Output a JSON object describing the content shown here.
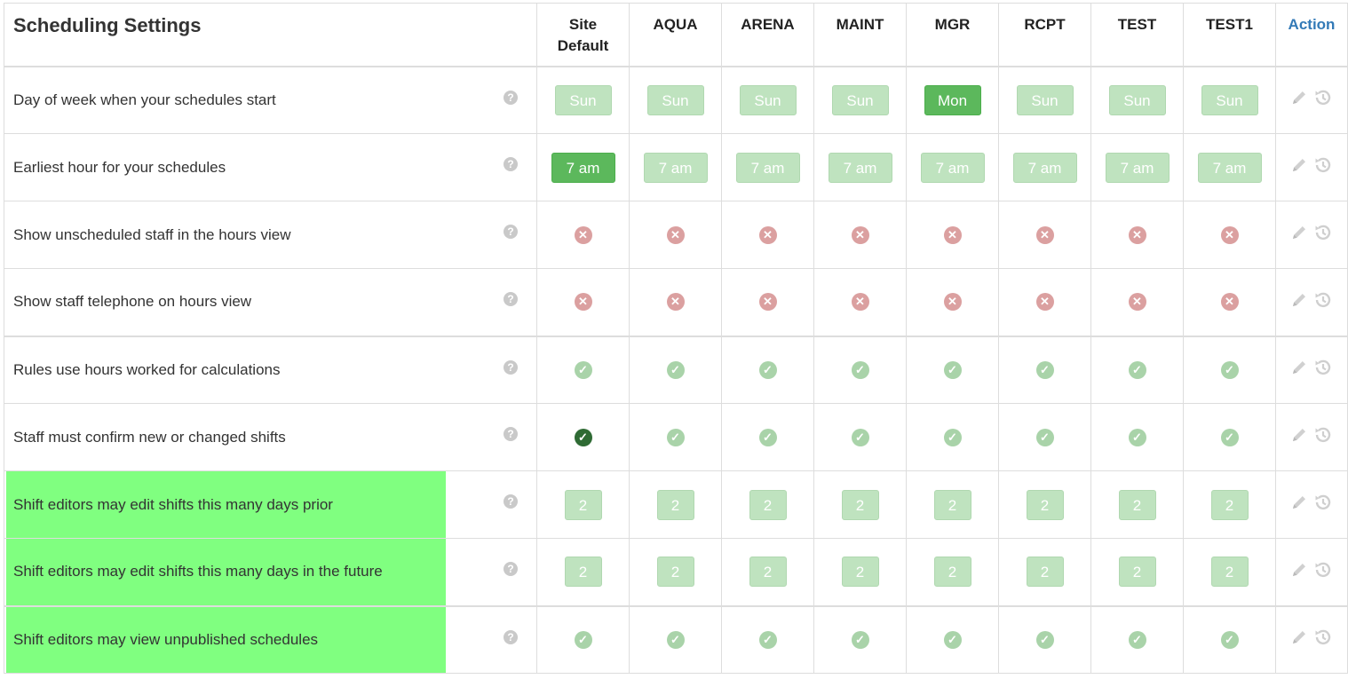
{
  "header": {
    "title": "Scheduling Settings",
    "columns": [
      "Site\nDefault",
      "AQUA",
      "ARENA",
      "MAINT",
      "MGR",
      "RCPT",
      "TEST",
      "TEST1"
    ],
    "action": "Action"
  },
  "help_glyph": "?",
  "colors": {
    "active_green": "#5cb85c",
    "inactive_green": "#bfe3bf",
    "no_red": "#dba0a0",
    "yes_green": "#a9d3a9",
    "yes_dark": "#2f6b34",
    "highlight": "#80ff80",
    "action_blue": "#337ab7"
  },
  "rows": [
    {
      "label": "Day of week when your schedules start",
      "type": "pill-day",
      "values": [
        "Sun",
        "Sun",
        "Sun",
        "Sun",
        "Mon",
        "Sun",
        "Sun",
        "Sun"
      ],
      "active": [
        false,
        false,
        false,
        false,
        true,
        false,
        false,
        false
      ]
    },
    {
      "label": "Earliest hour for your schedules",
      "type": "pill-hour",
      "values": [
        "7 am",
        "7 am",
        "7 am",
        "7 am",
        "7 am",
        "7 am",
        "7 am",
        "7 am"
      ],
      "active": [
        true,
        false,
        false,
        false,
        false,
        false,
        false,
        false
      ]
    },
    {
      "label": "Show unscheduled staff in the hours view",
      "type": "no",
      "values": [
        false,
        false,
        false,
        false,
        false,
        false,
        false,
        false
      ],
      "active": [
        false,
        false,
        false,
        false,
        false,
        false,
        false,
        false
      ]
    },
    {
      "label": "Show staff telephone on hours view",
      "type": "no",
      "values": [
        false,
        false,
        false,
        false,
        false,
        false,
        false,
        false
      ],
      "active": [
        false,
        false,
        false,
        false,
        false,
        false,
        false,
        false
      ]
    },
    {
      "label": "Rules use hours worked for calculations",
      "type": "yes",
      "values": [
        true,
        true,
        true,
        true,
        true,
        true,
        true,
        true
      ],
      "active": [
        false,
        false,
        false,
        false,
        false,
        false,
        false,
        false
      ]
    },
    {
      "label": "Staff must confirm new or changed shifts",
      "type": "yes",
      "values": [
        true,
        true,
        true,
        true,
        true,
        true,
        true,
        true
      ],
      "active": [
        true,
        false,
        false,
        false,
        false,
        false,
        false,
        false
      ]
    },
    {
      "label": "Shift editors may edit shifts this many days prior",
      "type": "pill-num",
      "values": [
        "2",
        "2",
        "2",
        "2",
        "2",
        "2",
        "2",
        "2"
      ],
      "active": [
        false,
        false,
        false,
        false,
        false,
        false,
        false,
        false
      ],
      "highlight": true
    },
    {
      "label": "Shift editors may edit shifts this many days in the future",
      "type": "pill-num",
      "values": [
        "2",
        "2",
        "2",
        "2",
        "2",
        "2",
        "2",
        "2"
      ],
      "active": [
        false,
        false,
        false,
        false,
        false,
        false,
        false,
        false
      ],
      "highlight": true
    },
    {
      "label": "Shift editors may view unpublished schedules",
      "type": "yes",
      "values": [
        true,
        true,
        true,
        true,
        true,
        true,
        true,
        true
      ],
      "active": [
        false,
        false,
        false,
        false,
        false,
        false,
        false,
        false
      ],
      "highlight": true
    }
  ]
}
